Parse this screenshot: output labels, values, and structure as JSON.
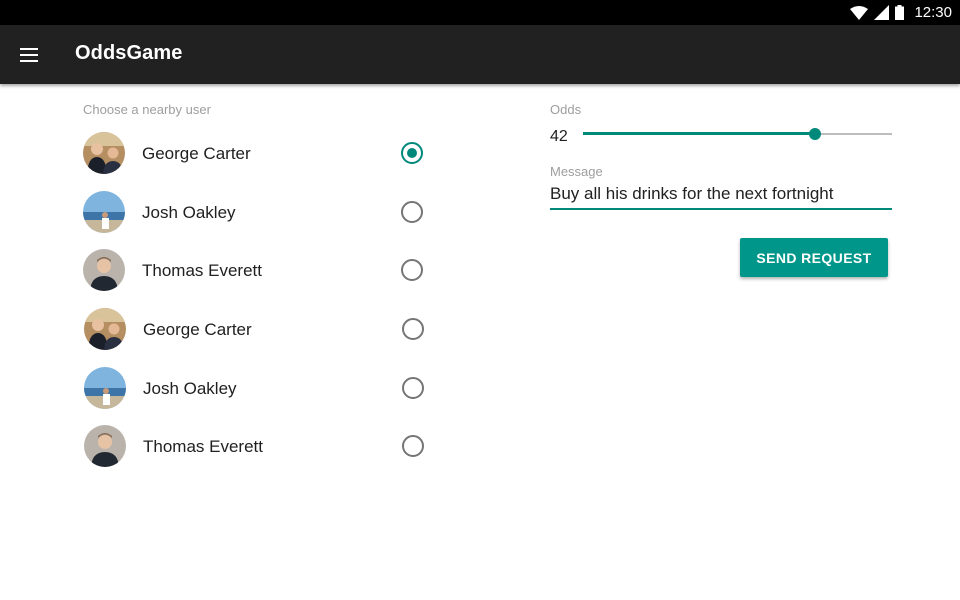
{
  "status_bar": {
    "time": "12:30",
    "icons": [
      "wifi-icon",
      "signal-icon",
      "battery-icon"
    ]
  },
  "app_bar": {
    "title": "OddsGame",
    "menu_icon": "menu-icon"
  },
  "user_picker": {
    "label": "Choose a nearby user",
    "users": [
      {
        "name": "George Carter",
        "avatar": "two-people-photo",
        "selected": true
      },
      {
        "name": "Josh Oakley",
        "avatar": "beach-photo",
        "selected": false
      },
      {
        "name": "Thomas Everett",
        "avatar": "portrait-photo",
        "selected": false
      },
      {
        "name": "George Carter",
        "avatar": "two-people-photo",
        "selected": false
      },
      {
        "name": "Josh Oakley",
        "avatar": "beach-photo",
        "selected": false
      },
      {
        "name": "Thomas Everett",
        "avatar": "portrait-photo",
        "selected": false
      }
    ]
  },
  "odds": {
    "label": "Odds",
    "value": "42",
    "slider_fraction": 0.75
  },
  "message": {
    "label": "Message",
    "value": "Buy all his drinks for the next fortnight"
  },
  "send_button": {
    "label": "SEND REQUEST"
  },
  "colors": {
    "accent": "#00897b",
    "app_bar": "#212121",
    "status_bar": "#000000"
  }
}
